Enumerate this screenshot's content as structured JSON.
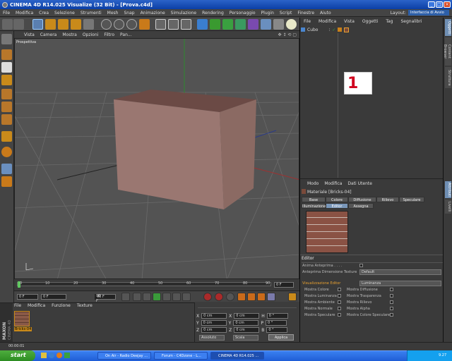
{
  "window": {
    "title": "CINEMA 4D R14.025 Visualize (32 Bit) - [Prova.c4d]"
  },
  "menu": [
    "File",
    "Modifica",
    "Crea",
    "Selezione",
    "Strumenti",
    "Mesh",
    "Snap",
    "Animazione",
    "Simulazione",
    "Rendering",
    "Personaggio",
    "Plugin",
    "Script",
    "Finestre",
    "Aiuto"
  ],
  "layout": {
    "label": "Layout:",
    "value": "Interfaccia di Avvio"
  },
  "viewport": {
    "menu": [
      "Vista",
      "Camera",
      "Mostra",
      "Opzioni",
      "Filtro",
      "Pan..."
    ],
    "label": "Prospettiva"
  },
  "timeline": {
    "ticks": [
      "0",
      "10",
      "20",
      "30",
      "40",
      "50",
      "60",
      "70",
      "80",
      "90"
    ],
    "end": "0 F"
  },
  "playback": {
    "start": "0 F",
    "current": "0 F",
    "end": "90 F",
    "max": "90 F"
  },
  "material_manager": {
    "menu": [
      "File",
      "Modifica",
      "Funzione",
      "Texture"
    ],
    "material_name": "Bricks-04"
  },
  "coords": {
    "rows": [
      {
        "axis": "X",
        "pos": "0 cm",
        "axis2": "X",
        "size": "0 cm",
        "axis3": "H",
        "rot": "0 °"
      },
      {
        "axis": "Y",
        "pos": "0 cm",
        "axis2": "Y",
        "size": "0 cm",
        "axis3": "P",
        "rot": "0 °"
      },
      {
        "axis": "Z",
        "pos": "0 cm",
        "axis2": "Z",
        "size": "0 cm",
        "axis3": "B",
        "rot": "0 °"
      }
    ],
    "mode": "Assoluto",
    "scale_mode": "Scala",
    "apply": "Applica"
  },
  "status": {
    "time": "00:00:01"
  },
  "logo": {
    "brand": "MAXON",
    "product": "CINEMA 4D"
  },
  "object_manager": {
    "menu": [
      "File",
      "Modifica",
      "Vista",
      "Oggetti",
      "Tag",
      "Segnalibri"
    ],
    "objects": [
      {
        "name": "Cubo"
      }
    ],
    "annotation": "1"
  },
  "attribute_manager": {
    "menu": [
      "Modo",
      "Modifica",
      "Dati Utente"
    ],
    "material_title": "Materiale [Bricks-04]",
    "tabs_row1": [
      "Base",
      "Colore",
      "Diffusione",
      "Rilievo",
      "Speculare"
    ],
    "tabs_row2": [
      "Illuminazione",
      "Editor",
      "Assegna"
    ],
    "section": "Editor",
    "anim_preview": "Anima Anteprima . . . .",
    "tex_preview_label": "Anteprima Dimensione Texture",
    "tex_preview_value": "Default",
    "view_editor_label": "Visualizzazione Editor",
    "view_editor_value": "Luminanza",
    "left_channels": [
      "Mostra Colore",
      "Mostra Luminanza",
      "Mostra Ambiente",
      "Mostra Normale",
      "Mostra Speculare"
    ],
    "right_channels": [
      "Mostra Diffusione",
      "Mostra Trasparenza",
      "Mostra Rilievo",
      "Mostra Alpha",
      "Mostra Colore Speculare"
    ]
  },
  "right_tabs": [
    "Oggetti",
    "Content Browser",
    "Struttura"
  ],
  "right_tabs_lower": [
    "Attributi",
    "Livelli"
  ],
  "taskbar": {
    "start": "start",
    "tasks": [
      "On Air - Radio Deejay ...",
      "Forum - C4Dzone - L...",
      "CINEMA 4D R14.025 ..."
    ],
    "clock": "9.27"
  },
  "colors": {
    "accent": "#7996b8",
    "selection": "#2d5fa8",
    "annotation": "#d0001e"
  }
}
